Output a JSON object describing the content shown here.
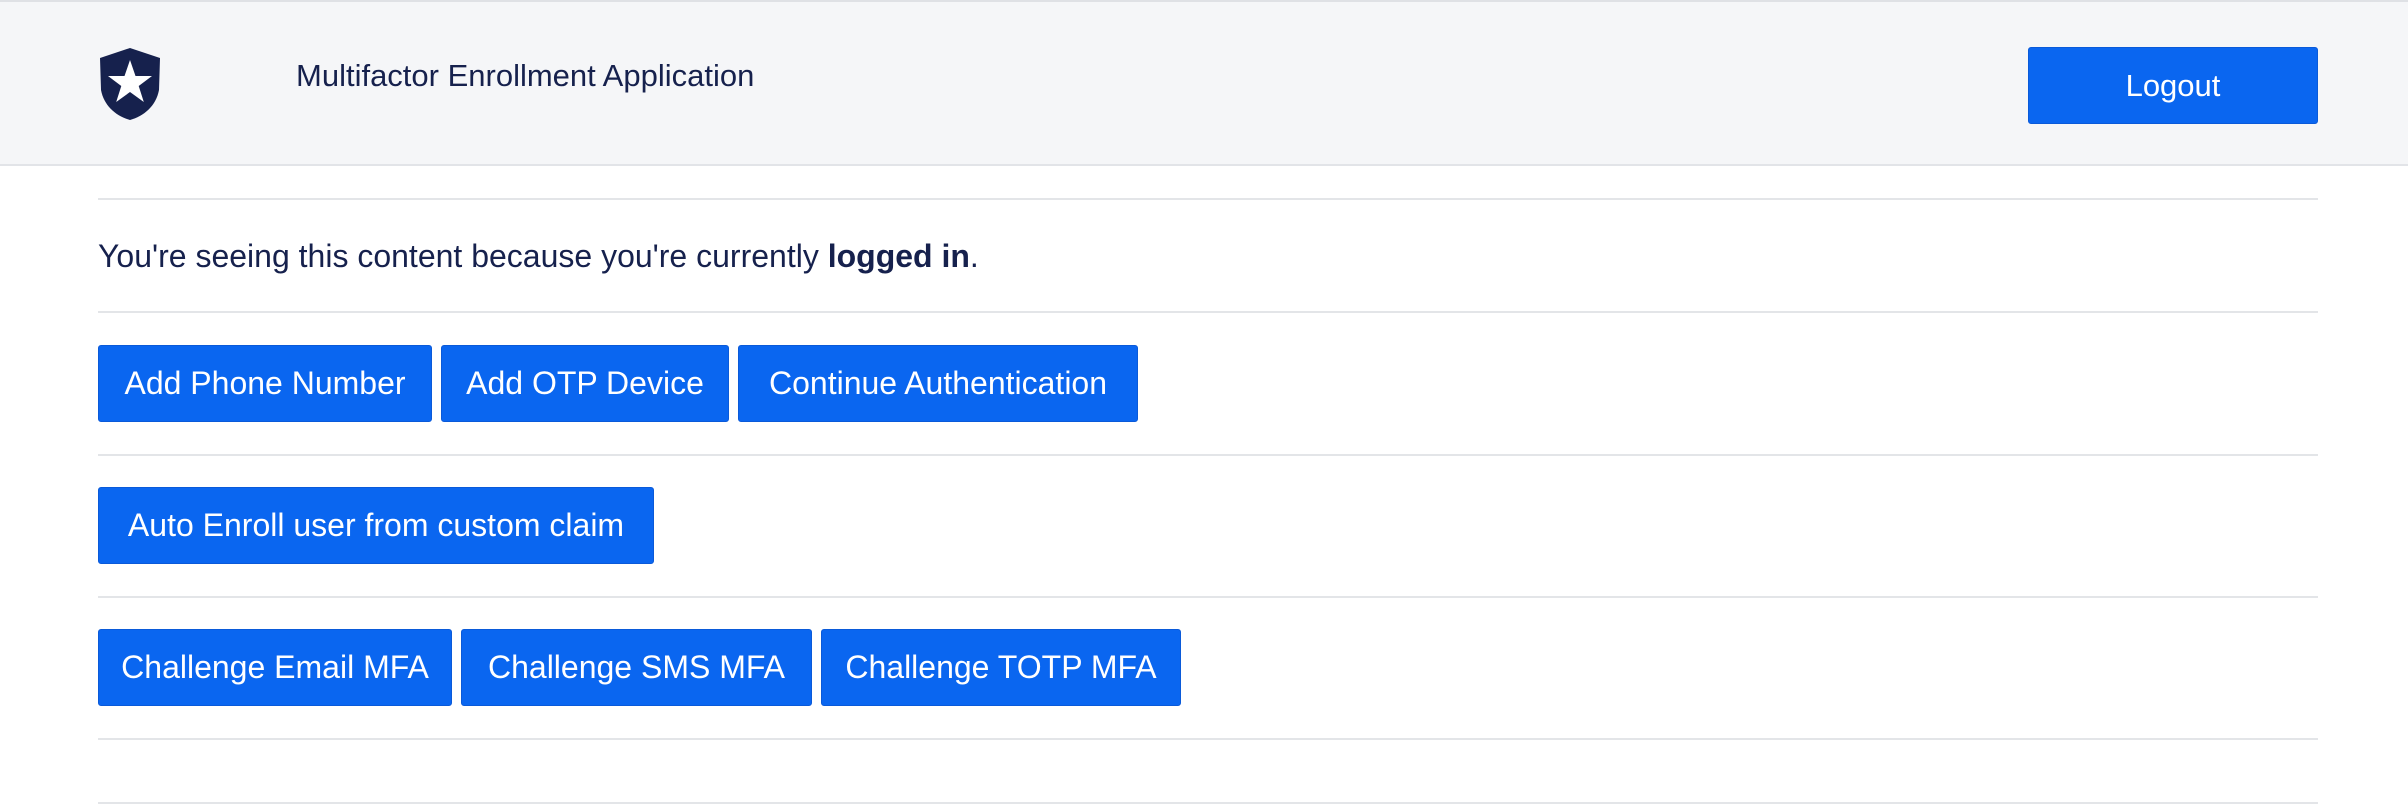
{
  "navbar": {
    "title": "Multifactor Enrollment Application",
    "logout_label": "Logout",
    "logo_icon": "shield-star-icon"
  },
  "notice": {
    "prefix": "You're seeing this content because you're currently ",
    "bold": "logged in",
    "suffix": "."
  },
  "rows": {
    "enroll": [
      "Add Phone Number",
      "Add OTP Device",
      "Continue Authentication"
    ],
    "auto": [
      "Auto Enroll user from custom claim"
    ],
    "challenge": [
      "Challenge Email MFA",
      "Challenge SMS MFA",
      "Challenge TOTP MFA"
    ]
  },
  "colors": {
    "primary": "#0a66f0",
    "navbar_bg": "#f5f6f8",
    "text": "#16214d",
    "divider": "#e3e5e8"
  }
}
